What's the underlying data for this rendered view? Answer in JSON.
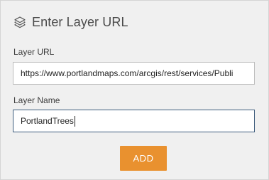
{
  "header": {
    "icon": "layers-icon",
    "title": "Enter Layer URL"
  },
  "layer_url": {
    "label": "Layer URL",
    "value": "https://www.portlandmaps.com/arcgis/rest/services/Publi"
  },
  "layer_name": {
    "label": "Layer Name",
    "value": "PortlandTrees"
  },
  "actions": {
    "add_label": "ADD"
  },
  "colors": {
    "accent": "#e9912f",
    "panel_bg": "#f0f0f0",
    "focus_border": "#3e5d7d"
  }
}
